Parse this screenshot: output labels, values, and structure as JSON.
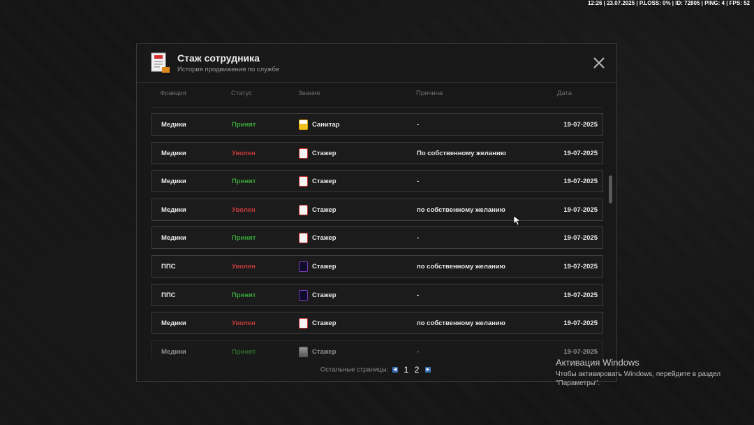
{
  "hud": {
    "text": "12:26 | 23.07.2025 | P.LOSS: 0% | ID: 72805 | PING: 4 | FPS: 52"
  },
  "modal": {
    "title": "Стаж сотрудника",
    "subtitle": "История продвижения по службе",
    "columns": {
      "faction": "Фракция",
      "status": "Статус",
      "rank": "Звание",
      "reason": "Причина",
      "date": "Дата"
    },
    "rows": [
      {
        "faction": "Медики",
        "status": "Принят",
        "status_type": "accepted",
        "rank_icon": "sanitar-icon",
        "rank": "Санитар",
        "reason": "-",
        "date": "19-07-2025"
      },
      {
        "faction": "Медики",
        "status": "Уволен",
        "status_type": "fired",
        "rank_icon": "stazher-med-icon",
        "rank": "Стажер",
        "reason": "По собственному желанию",
        "date": "19-07-2025"
      },
      {
        "faction": "Медики",
        "status": "Принят",
        "status_type": "accepted",
        "rank_icon": "stazher-med-icon",
        "rank": "Стажер",
        "reason": "-",
        "date": "19-07-2025"
      },
      {
        "faction": "Медики",
        "status": "Уволен",
        "status_type": "fired",
        "rank_icon": "stazher-med-icon",
        "rank": "Стажер",
        "reason": "по собственному желанию",
        "date": "19-07-2025"
      },
      {
        "faction": "Медики",
        "status": "Принят",
        "status_type": "accepted",
        "rank_icon": "stazher-med-icon",
        "rank": "Стажер",
        "reason": "-",
        "date": "19-07-2025"
      },
      {
        "faction": "ППС",
        "status": "Уволен",
        "status_type": "fired",
        "rank_icon": "stazher-pps-icon",
        "rank": "Стажер",
        "reason": "по собственному желанию",
        "date": "19-07-2025"
      },
      {
        "faction": "ППС",
        "status": "Принят",
        "status_type": "accepted",
        "rank_icon": "stazher-pps-icon",
        "rank": "Стажер",
        "reason": "-",
        "date": "19-07-2025"
      },
      {
        "faction": "Медики",
        "status": "Уволен",
        "status_type": "fired",
        "rank_icon": "stazher-med-icon",
        "rank": "Стажер",
        "reason": "по собственному желанию",
        "date": "19-07-2025"
      },
      {
        "faction": "Медики",
        "status": "Принят",
        "status_type": "accepted",
        "rank_icon": "stazher-grey-icon",
        "rank": "Стажер",
        "reason": "-",
        "date": "19-07-2025"
      }
    ],
    "pager": {
      "label": "Остальные страницы:",
      "pages": [
        "1",
        "2"
      ]
    }
  },
  "colors": {
    "accepted": "#3aa83a",
    "fired": "#c03a3a"
  },
  "windows": {
    "title": "Активация Windows",
    "text": "Чтобы активировать Windows, перейдите в раздел \"Параметры\"."
  }
}
